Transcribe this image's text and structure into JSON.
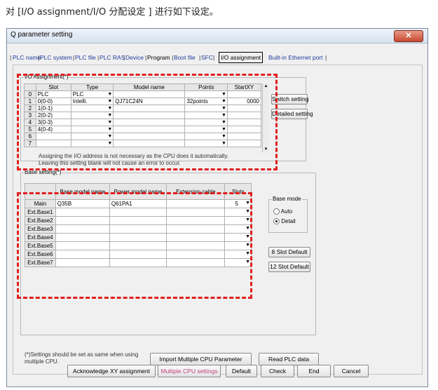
{
  "caption": "对 [I/O assignment/I/O 分配设定 ] 进行如下设定。",
  "window": {
    "title": "Q parameter setting",
    "close_label": "✕"
  },
  "tabs": [
    "PLC name",
    "PLC system",
    "PLC file",
    "PLC RAS",
    "Device",
    "Program",
    "Boot file",
    "SFC",
    "I/O assignment",
    "Built-in Ethernet port"
  ],
  "io_assignment": {
    "group_label": "I/O Assignment(*)",
    "headers": [
      "Slot",
      "Type",
      "Model name",
      "Points",
      "StartXY"
    ],
    "rows": [
      {
        "no": "0",
        "slot": "PLC",
        "type": "PLC",
        "model": "",
        "points": "",
        "start": ""
      },
      {
        "no": "1",
        "slot": "0(0-0)",
        "type": "Intelli.",
        "model": "QJ71C24N",
        "points": "32points",
        "start": "0000"
      },
      {
        "no": "2",
        "slot": "1(0-1)",
        "type": "",
        "model": "",
        "points": "",
        "start": ""
      },
      {
        "no": "3",
        "slot": "2(0-2)",
        "type": "",
        "model": "",
        "points": "",
        "start": ""
      },
      {
        "no": "4",
        "slot": "3(0-3)",
        "type": "",
        "model": "",
        "points": "",
        "start": ""
      },
      {
        "no": "5",
        "slot": "4(0-4)",
        "type": "",
        "model": "",
        "points": "",
        "start": ""
      },
      {
        "no": "6",
        "slot": "",
        "type": "",
        "model": "",
        "points": "",
        "start": ""
      },
      {
        "no": "7",
        "slot": "",
        "type": "",
        "model": "",
        "points": "",
        "start": ""
      }
    ],
    "note1": "Assigning the I/O address is not necessary as the CPU does it automatically.",
    "note2": "Leaving this setting blank will not cause an error to occur.",
    "switch_setting": "Switch setting",
    "detailed_setting": "Detailed setting"
  },
  "base_setting": {
    "group_label": "Base setting(*)",
    "headers": [
      "Base model name",
      "Power model name",
      "Extension cable",
      "Slots"
    ],
    "rows": [
      {
        "name": "Main",
        "base": "Q35B",
        "power": "Q61PA1",
        "cable": "",
        "slots": "5"
      },
      {
        "name": "Ext.Base1",
        "base": "",
        "power": "",
        "cable": "",
        "slots": ""
      },
      {
        "name": "Ext.Base2",
        "base": "",
        "power": "",
        "cable": "",
        "slots": ""
      },
      {
        "name": "Ext.Base3",
        "base": "",
        "power": "",
        "cable": "",
        "slots": ""
      },
      {
        "name": "Ext.Base4",
        "base": "",
        "power": "",
        "cable": "",
        "slots": ""
      },
      {
        "name": "Ext.Base5",
        "base": "",
        "power": "",
        "cable": "",
        "slots": ""
      },
      {
        "name": "Ext.Base6",
        "base": "",
        "power": "",
        "cable": "",
        "slots": ""
      },
      {
        "name": "Ext.Base7",
        "base": "",
        "power": "",
        "cable": "",
        "slots": ""
      }
    ],
    "base_mode_label": "Base mode",
    "auto_label": "Auto",
    "detail_label": "Detail",
    "slot8_default": "8 Slot Default",
    "slot12_default": "12 Slot Default"
  },
  "footer_note": "(*)Settings should be set as same when using multiple CPU.",
  "import_multi": "Import Multiple CPU Parameter",
  "read_plc": "Read PLC data",
  "bottom_buttons": {
    "acknowledge": "Acknowledge XY assignment",
    "multi_cpu": "Multiple CPU settings",
    "default": "Default",
    "check": "Check",
    "end": "End",
    "cancel": "Cancel"
  },
  "colors": {
    "highlight_box": "#e02020",
    "link_tab": "#1f3c9c",
    "multi_cpu_text": "#c0427a"
  }
}
